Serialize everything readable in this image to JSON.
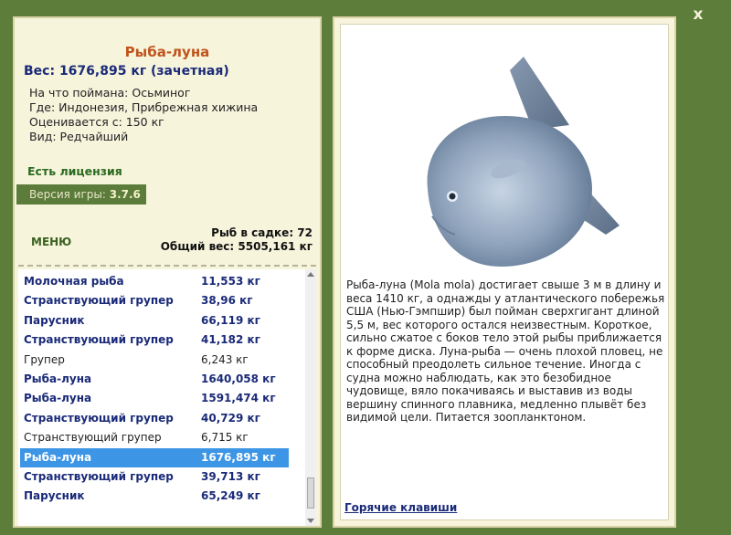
{
  "window": {
    "close_label": "x"
  },
  "fish_card": {
    "name": "Рыба-луна",
    "weight": "Вес: 1676,895 кг (зачетная)",
    "caught_on": "На что поймана: Осьминог",
    "location": "Где: Индонезия, Прибрежная хижина",
    "value": "Оценивается с: 150 кг",
    "rarity": "Вид: Редчайший"
  },
  "license": "Есть лицензия",
  "version": {
    "label": "Версия игры:",
    "value": "3.7.6"
  },
  "menu_label": "МЕНЮ",
  "stats": {
    "fish_count": "Рыб в садке: 72",
    "total_weight": "Общий вес: 5505,161 кг"
  },
  "catch_list": [
    {
      "name": "Молочная рыба",
      "weight": "11,553 кг",
      "bold": true
    },
    {
      "name": "Странствующий групер",
      "weight": "38,96 кг",
      "bold": true
    },
    {
      "name": "Парусник",
      "weight": "66,119 кг",
      "bold": true
    },
    {
      "name": "Странствующий групер",
      "weight": "41,182 кг",
      "bold": true
    },
    {
      "name": "Групер",
      "weight": "6,243 кг",
      "bold": false
    },
    {
      "name": "Рыба-луна",
      "weight": "1640,058 кг",
      "bold": true
    },
    {
      "name": "Рыба-луна",
      "weight": "1591,474 кг",
      "bold": true
    },
    {
      "name": "Странствующий групер",
      "weight": "40,729 кг",
      "bold": true
    },
    {
      "name": "Странствующий групер",
      "weight": "6,715 кг",
      "bold": false
    },
    {
      "name": "Рыба-луна",
      "weight": "1676,895 кг",
      "bold": true,
      "selected": true
    },
    {
      "name": "Странствующий групер",
      "weight": "39,713 кг",
      "bold": true
    },
    {
      "name": "Парусник",
      "weight": "65,249 кг",
      "bold": true
    }
  ],
  "description": "Рыба-луна (Mola mola) достигает свыше 3 м в длину и веса 1410 кг, а однажды у атлантического побережья США (Нью-Гэмпшир) был пойман сверхгигант длиной 5,5 м, вес которого остался неизвестным. Короткое, сильно сжатое с боков тело этой рыбы приближается к форме диска. Луна-рыба — очень плохой пловец, не способный преодолеть сильное течение. Иногда с судна можно наблюдать, как это безобидное чудовище, вяло покачиваясь и выставив из воды вершину спинного плавника, медленно плывёт без видимой цели. Питается зоопланктоном.",
  "hotkeys_label": "Горячие клавиши",
  "colors": {
    "frame": "#5d7d3b",
    "panel": "#f7f4dc",
    "selected_row": "#3d95e5",
    "fish_name": "#c0541c",
    "link_blue": "#1a2a78"
  }
}
